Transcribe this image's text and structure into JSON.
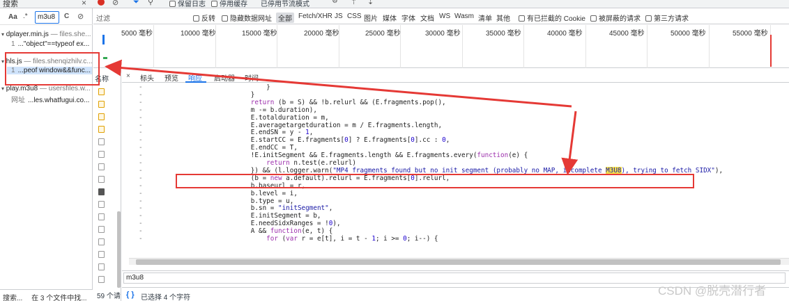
{
  "search_panel": {
    "tab_label": "搜索",
    "close_glyph": "×",
    "case_label": "Aa",
    "regex_label": ".*",
    "query": "m3u8",
    "refresh_glyph": "C",
    "clear_glyph": "⊘",
    "results": [
      {
        "file": "dplayer.min.js",
        "host": "— files.she...",
        "line_no": "1",
        "snippet": "...\"object\"==typeof ex..."
      },
      {
        "file": "hls.js",
        "host": "— files.shenqizhilv.c...",
        "line_no": "1",
        "snippet": "...peof window&&func..."
      },
      {
        "file": "play.m3u8",
        "host": "— usersfiles.w...",
        "line_no": "网址",
        "snippet": "...les.whatfugui.co..."
      }
    ],
    "status_left": "搜索...",
    "status_right": "在 3 个文件中找..."
  },
  "toolbar": {
    "preserve_log": "保留日志",
    "disable_cache": "停用缓存",
    "throttle": "已停用节流模式"
  },
  "filter_bar": {
    "placeholder": "过滤",
    "invert": "反转",
    "hide_data_urls": "隐藏数据网址",
    "all": "全部",
    "types": [
      "Fetch/XHR",
      "JS",
      "CSS",
      "图片",
      "媒体",
      "字体",
      "文档",
      "WS",
      "Wasm",
      "清单",
      "其他"
    ],
    "blocked_cookies": "有已拦截的 Cookie",
    "blocked_requests": "被屏蔽的请求",
    "third_party": "第三方请求"
  },
  "timeline": {
    "ticks": [
      "5000 毫秒",
      "10000 毫秒",
      "15000 毫秒",
      "20000 毫秒",
      "25000 毫秒",
      "30000 毫秒",
      "35000 毫秒",
      "40000 毫秒",
      "45000 毫秒",
      "50000 毫秒",
      "55000 毫秒"
    ]
  },
  "request_list": {
    "header": "名称",
    "count": "59 个请"
  },
  "source_tabs": {
    "close": "×",
    "headers": "标头",
    "preview": "预览",
    "response": "响应",
    "initiator": "启动器",
    "timing": "时间"
  },
  "code": {
    "gutter": "-",
    "lines": [
      "            }",
      "        }",
      "        return (b = S) && !b.relurl && (E.fragments.pop(),",
      "        m -= b.duration),",
      "        E.totalduration = m,",
      "        E.averagetargetduration = m / E.fragments.length,",
      "        E.endSN = y - 1,",
      "        E.startCC = E.fragments[0] ? E.fragments[0].cc : 0,",
      "        E.endCC = T,",
      "        !E.initSegment && E.fragments.length && E.fragments.every(function(e) {",
      "            return n.test(e.relurl)",
      "        }) && (l.logger.warn(\"MP4 fragments found but no init segment (probably no MAP, incomplete M3U8), trying to fetch SIDX\"),",
      "        (b = new a.default).relurl = E.fragments[0].relurl,",
      "        b.baseurl = r,",
      "        b.level = i,",
      "        b.type = u,",
      "        b.sn = \"initSegment\",",
      "        E.initSegment = b,",
      "        E.needSidxRanges = !0),",
      "        A && function(e, t) {",
      "            for (var r = e[t], i = t - 1; i >= 0; i--) {"
    ]
  },
  "find_bar": {
    "value": "m3u8"
  },
  "status_bar": {
    "braces": "{ }",
    "selection": "已选择 4 个字符"
  },
  "watermark": "CSDN @脱壳潜行者",
  "colors": {
    "annotation_red": "#e53935",
    "accent_blue": "#1a73e8",
    "highlight_yellow": "#f7e24b"
  }
}
